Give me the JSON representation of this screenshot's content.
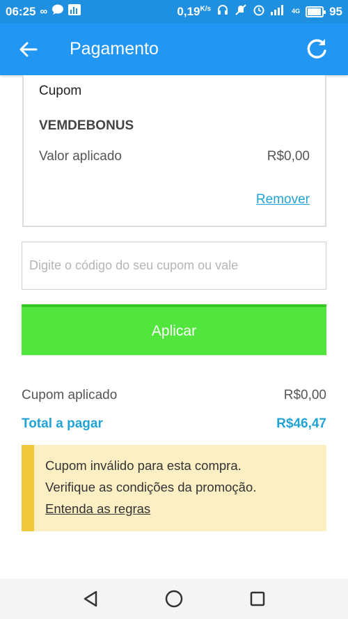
{
  "status_bar": {
    "time": "06:25",
    "speed": "0,19",
    "speed_unit": "K/s",
    "network": "4G",
    "battery": "95",
    "icons": [
      "infinity-icon",
      "chat-icon",
      "chart-icon",
      "headphones-icon",
      "mute-icon",
      "alarm-icon",
      "signal-icon",
      "battery-icon"
    ]
  },
  "app_bar": {
    "title": "Pagamento",
    "back_icon": "arrow-left-icon",
    "refresh_icon": "refresh-icon"
  },
  "coupon_card": {
    "label": "Cupom",
    "code": "VEMDEBONUS",
    "applied_label": "Valor aplicado",
    "applied_value": "R$0,00",
    "remove_label": "Remover"
  },
  "coupon_input": {
    "placeholder": "Digite o código do seu cupom ou vale",
    "value": ""
  },
  "apply_button": {
    "label": "Aplicar"
  },
  "summary": {
    "coupon_applied_label": "Cupom aplicado",
    "coupon_applied_value": "R$0,00",
    "total_label": "Total a pagar",
    "total_value": "R$46,47"
  },
  "warning": {
    "line1": "Cupom inválido para esta compra.",
    "line2": "Verifique as condições da promoção.",
    "link": "Entenda as regras"
  },
  "colors": {
    "app_bar": "#2196f3",
    "status_bar": "#1f8fe0",
    "apply_button": "#52e53d",
    "link_accent": "#21a3d6",
    "warning_bg": "#fcefc4",
    "warning_stripe": "#f0c83a"
  },
  "nav_bar": {
    "icons": [
      "back-triangle-icon",
      "home-circle-icon",
      "recents-square-icon"
    ]
  }
}
